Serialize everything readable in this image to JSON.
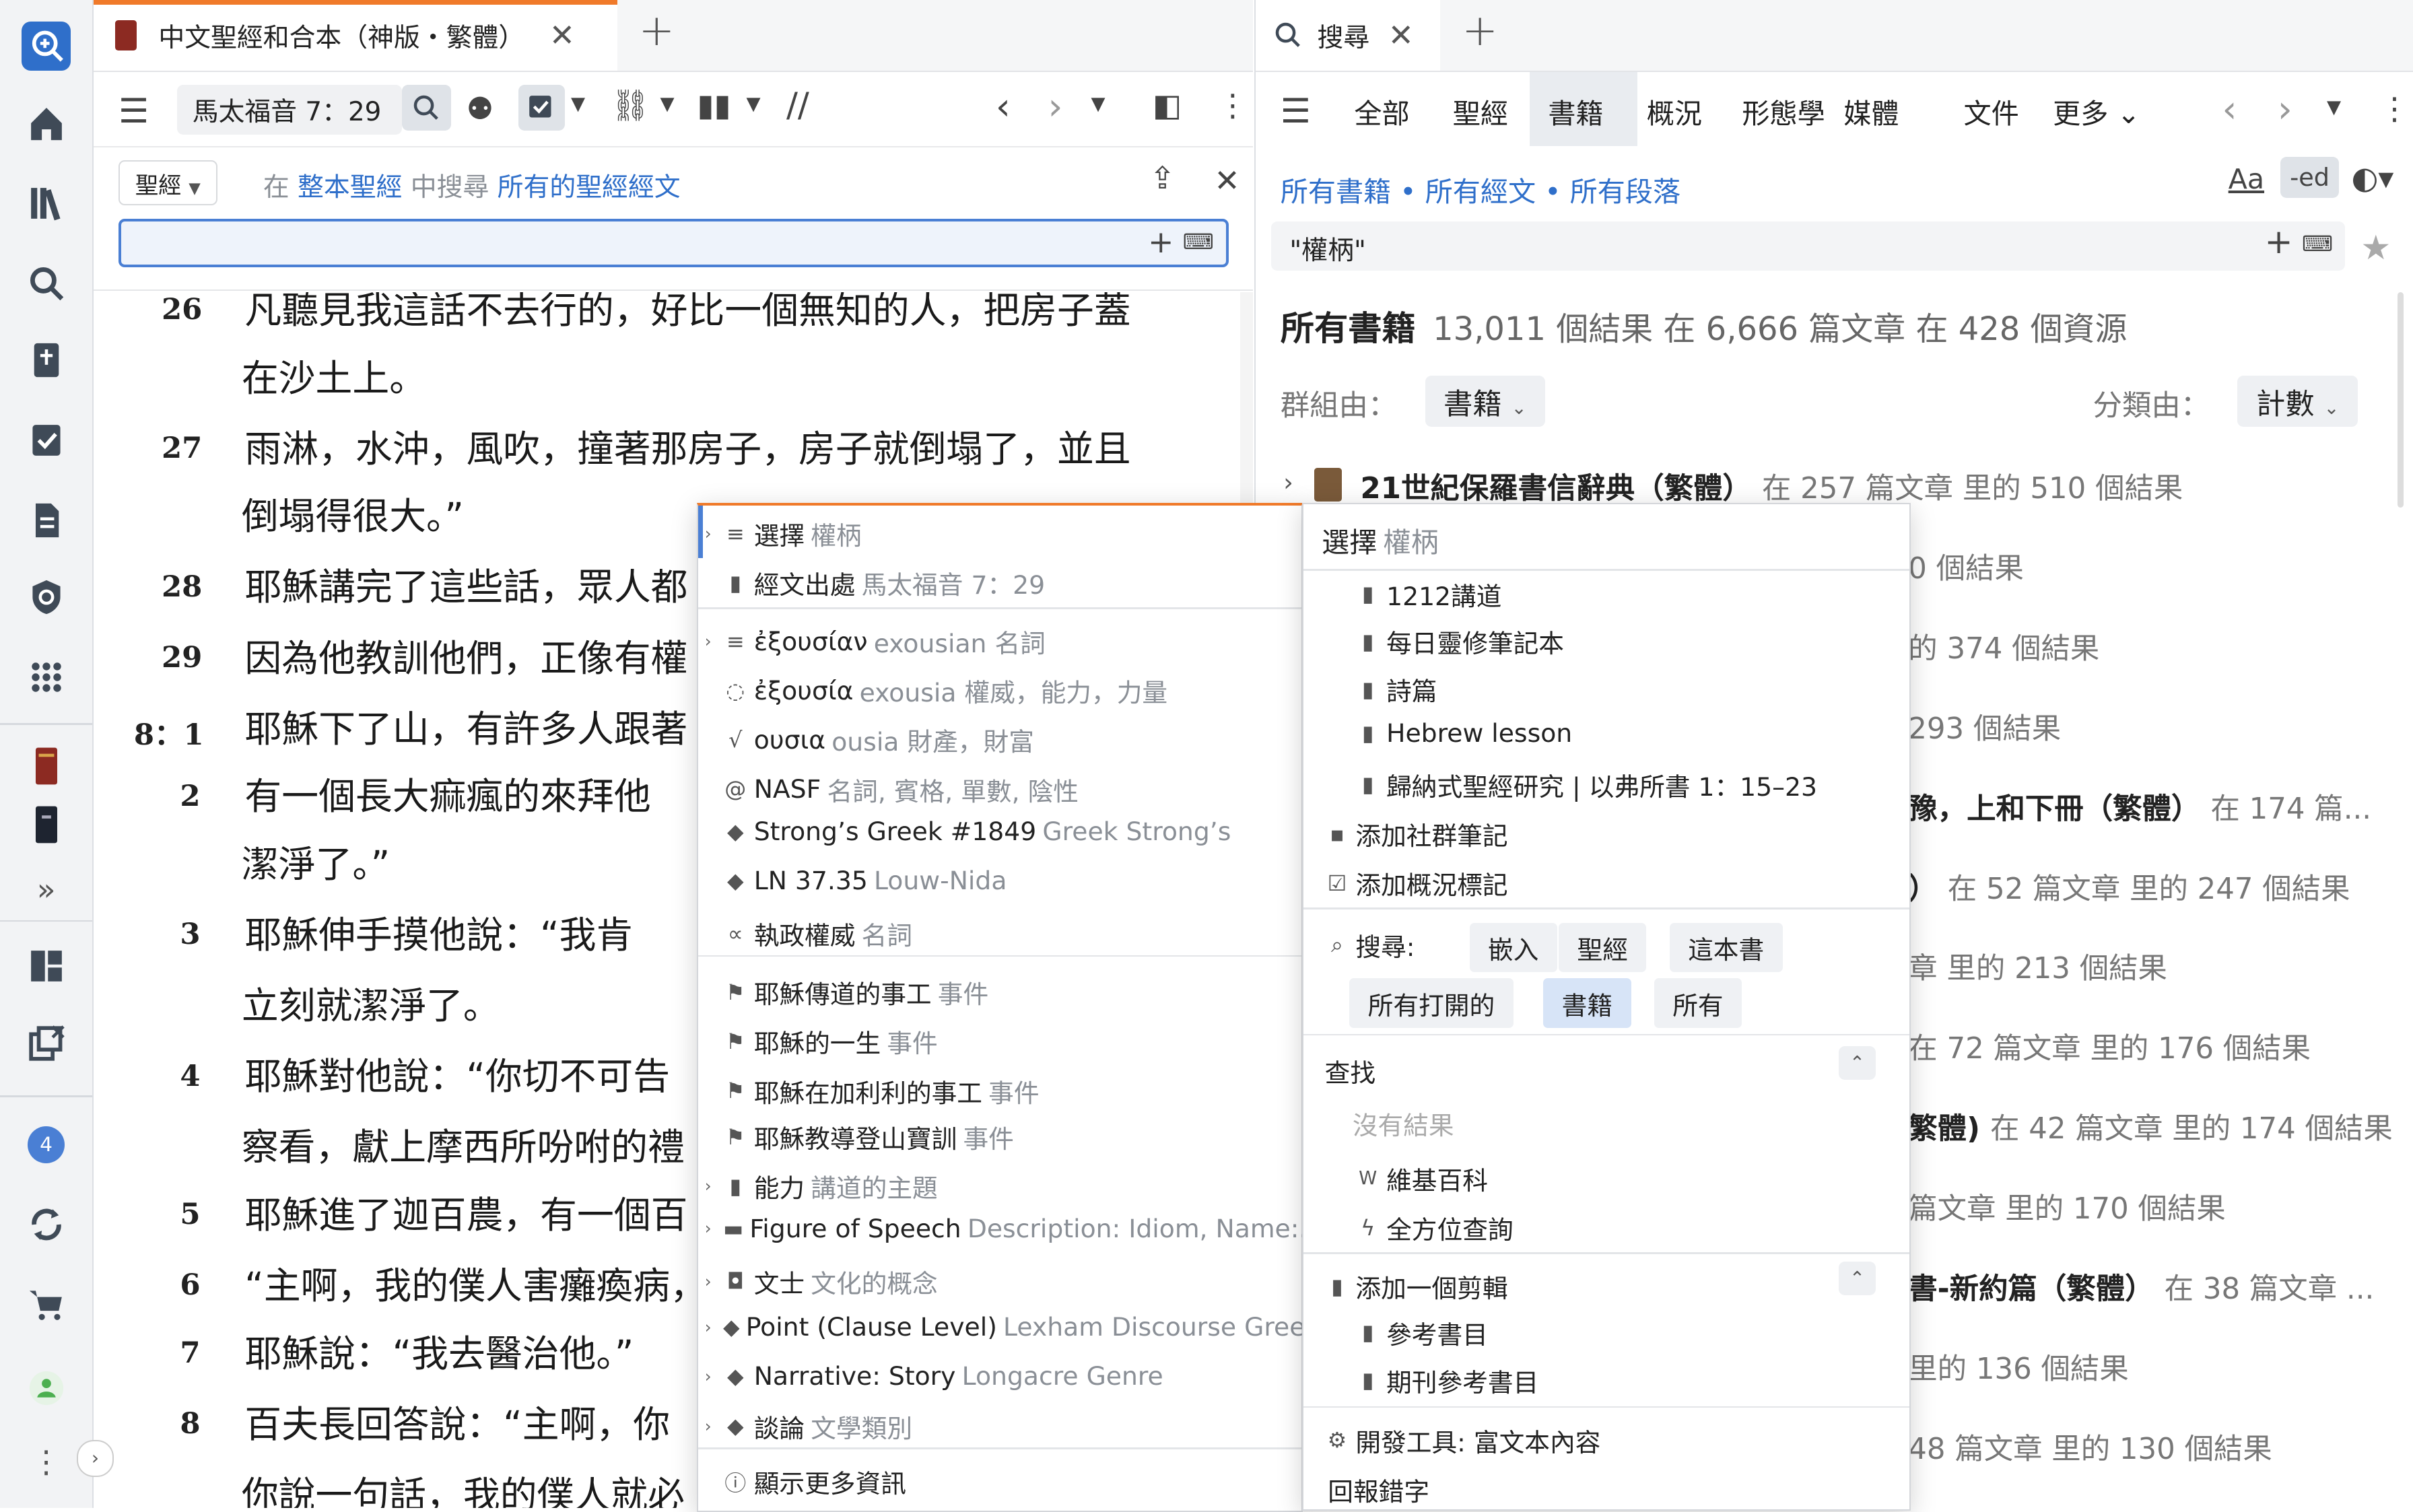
{
  "left_tab": {
    "title": "中文聖經和合本（神版・繁體）"
  },
  "right_tab": {
    "title": "搜尋"
  },
  "left_toolbar": {
    "reference": "馬太福音 7：29"
  },
  "search_bar": {
    "scope_label": "聖經",
    "prefix": "在",
    "scope_link": "整本聖經",
    "mid": "中搜尋",
    "target_link": "所有的聖經經文"
  },
  "verses": [
    {
      "num": "26",
      "text": "凡聽見我這話不去行的，好比一個無知的人，把房子蓋"
    },
    {
      "num": "",
      "text": "在沙土上。"
    },
    {
      "num": "27",
      "text": "雨淋，水沖，風吹，撞著那房子，房子就倒塌了，並且"
    },
    {
      "num": "",
      "text": "倒塌得很大。”"
    },
    {
      "num": "28",
      "text": "耶穌講完了這些話，眾人都"
    },
    {
      "num": "29",
      "text": "因為他教訓他們，正像有權"
    },
    {
      "num": "8：1",
      "text": "耶穌下了山，有許多人跟著"
    },
    {
      "num": "2",
      "text": "有一個長大痲瘋的來拜他"
    },
    {
      "num": "",
      "text": "潔淨了。”"
    },
    {
      "num": "3",
      "text": "耶穌伸手摸他說：“我肯"
    },
    {
      "num": "",
      "text": "立刻就潔淨了。"
    },
    {
      "num": "4",
      "text": "耶穌對他說：“你切不可告"
    },
    {
      "num": "",
      "text": "察看，獻上摩西所吩咐的禮"
    },
    {
      "num": "5",
      "text": "耶穌進了迦百農，有一個百"
    },
    {
      "num": "6",
      "text": "“主啊，我的僕人害癱瘓病，"
    },
    {
      "num": "7",
      "text": "耶穌說：“我去醫治他。”"
    },
    {
      "num": "8",
      "text": "百夫長回答說：“主啊，你"
    },
    {
      "num": "",
      "text": "你說一句話，我的僕人就必"
    }
  ],
  "right_pane": {
    "menu_tabs": [
      "全部",
      "聖經",
      "書籍",
      "概況",
      "形態學",
      "媒體",
      "文件",
      "更多"
    ],
    "filter": {
      "books": "所有書籍",
      "verses": "所有經文",
      "passages": "所有段落"
    },
    "format_buttons": {
      "aa": "Aa",
      "ed": "-ed"
    },
    "query": "\"權柄\"",
    "summary_title": "所有書籍",
    "summary_text": "13,011 個結果 在 6,666 篇文章 在 428 個資源",
    "group_label": "群組由：",
    "group_value": "書籍",
    "sort_label": "分類由：",
    "sort_value": "計數",
    "results": [
      {
        "title": "21世紀保羅書信辭典（繁體）",
        "rest": "在 257 篇文章 里的 510 個結果"
      },
      {
        "title": "",
        "rest": "0 個結果"
      },
      {
        "title": "",
        "rest": "的 374 個結果"
      },
      {
        "title": "",
        "rest": "293 個結果"
      },
      {
        "title": "豫，上和下冊（繁體）",
        "rest": "在 174 篇..."
      },
      {
        "title": "）",
        "rest": "在 52 篇文章 里的 247 個結果"
      },
      {
        "title": "",
        "rest": "章 里的 213 個結果"
      },
      {
        "title": "",
        "rest": "在 72 篇文章 里的 176 個結果"
      },
      {
        "title": "繁體)",
        "rest": "在 42 篇文章 里的 174 個結果"
      },
      {
        "title": "",
        "rest": "篇文章 里的 170 個結果"
      },
      {
        "title": "書-新約篇（繁體）",
        "rest": "在 38 篇文章 ..."
      },
      {
        "title": "",
        "rest": "里的 136 個結果"
      },
      {
        "title": "",
        "rest": "48 篇文章 里的 130 個結果"
      }
    ]
  },
  "context_menu": {
    "items": [
      {
        "icon": "≡",
        "label": "選擇",
        "sub": "權柄"
      },
      {
        "icon": "▮",
        "label": "經文出處",
        "sub": "馬太福音 7：29"
      },
      {
        "icon": "≡",
        "label": "ἐξουσίαν",
        "sub": "exousian 名詞"
      },
      {
        "icon": "◌",
        "label": "ἐξουσία",
        "sub": "exousia 權威，能力，力量"
      },
      {
        "icon": "√",
        "label": "ουσια",
        "sub": "ousia 財產，財富"
      },
      {
        "icon": "@",
        "label": "NASF",
        "sub": "名詞, 賓格, 單數, 陰性"
      },
      {
        "icon": "◆",
        "label": "Strong’s Greek #1849",
        "sub": "Greek Strong’s"
      },
      {
        "icon": "◆",
        "label": "LN 37.35",
        "sub": "Louw-Nida"
      },
      {
        "icon": "∝",
        "label": "執政權威",
        "sub": "名詞"
      },
      {
        "icon": "⚑",
        "label": "耶穌傳道的事工",
        "sub": "事件"
      },
      {
        "icon": "⚑",
        "label": "耶穌的一生",
        "sub": "事件"
      },
      {
        "icon": "⚑",
        "label": "耶穌在加利利的事工",
        "sub": "事件"
      },
      {
        "icon": "⚑",
        "label": "耶穌教導登山寶訓",
        "sub": "事件"
      },
      {
        "icon": "▮",
        "label": "能力",
        "sub": "講道的主題"
      },
      {
        "icon": "▬",
        "label": "Figure of Speech",
        "sub": "Description: Idiom, Name:..."
      },
      {
        "icon": "◘",
        "label": "文士",
        "sub": "文化的概念"
      },
      {
        "icon": "◆",
        "label": "Point (Clause Level)",
        "sub": "Lexham Discourse Gree..."
      },
      {
        "icon": "◆",
        "label": "Narrative: Story",
        "sub": "Longacre Genre"
      },
      {
        "icon": "◆",
        "label": "談論",
        "sub": "文學類別"
      },
      {
        "icon": "ⓘ",
        "label": "顯示更多資訊",
        "sub": ""
      }
    ]
  },
  "submenu": {
    "header_label": "選擇",
    "header_sub": "權柄",
    "notebooks": [
      "1212講道",
      "每日靈修筆記本",
      "詩篇",
      "Hebrew lesson",
      "歸納式聖經研究 | 以弗所書 1：15–23"
    ],
    "add_community_note": "添加社群筆記",
    "add_status_tag": "添加概況標記",
    "search_label": "搜尋:",
    "search_chips": [
      "嵌入",
      "聖經",
      "這本書",
      "所有打開的",
      "書籍",
      "所有"
    ],
    "find_label": "查找",
    "no_results": "沒有結果",
    "wiki": "維基百科",
    "omni": "全方位查詢",
    "add_clipping": "添加一個剪輯",
    "clippings": [
      "參考書目",
      "期刊參考書目"
    ],
    "dev_tools": "開發工具: 富文本內容",
    "report_error": "回報錯字"
  },
  "rail": {
    "badge": "4"
  }
}
